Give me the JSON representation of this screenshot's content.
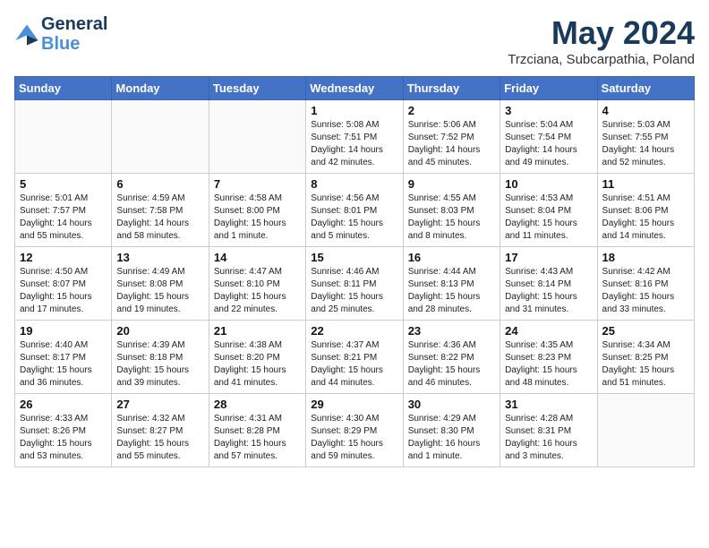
{
  "header": {
    "logo_line1": "General",
    "logo_line2": "Blue",
    "month_title": "May 2024",
    "location": "Trzciana, Subcarpathia, Poland"
  },
  "weekdays": [
    "Sunday",
    "Monday",
    "Tuesday",
    "Wednesday",
    "Thursday",
    "Friday",
    "Saturday"
  ],
  "weeks": [
    [
      {
        "day": "",
        "info": ""
      },
      {
        "day": "",
        "info": ""
      },
      {
        "day": "",
        "info": ""
      },
      {
        "day": "1",
        "info": "Sunrise: 5:08 AM\nSunset: 7:51 PM\nDaylight: 14 hours\nand 42 minutes."
      },
      {
        "day": "2",
        "info": "Sunrise: 5:06 AM\nSunset: 7:52 PM\nDaylight: 14 hours\nand 45 minutes."
      },
      {
        "day": "3",
        "info": "Sunrise: 5:04 AM\nSunset: 7:54 PM\nDaylight: 14 hours\nand 49 minutes."
      },
      {
        "day": "4",
        "info": "Sunrise: 5:03 AM\nSunset: 7:55 PM\nDaylight: 14 hours\nand 52 minutes."
      }
    ],
    [
      {
        "day": "5",
        "info": "Sunrise: 5:01 AM\nSunset: 7:57 PM\nDaylight: 14 hours\nand 55 minutes."
      },
      {
        "day": "6",
        "info": "Sunrise: 4:59 AM\nSunset: 7:58 PM\nDaylight: 14 hours\nand 58 minutes."
      },
      {
        "day": "7",
        "info": "Sunrise: 4:58 AM\nSunset: 8:00 PM\nDaylight: 15 hours\nand 1 minute."
      },
      {
        "day": "8",
        "info": "Sunrise: 4:56 AM\nSunset: 8:01 PM\nDaylight: 15 hours\nand 5 minutes."
      },
      {
        "day": "9",
        "info": "Sunrise: 4:55 AM\nSunset: 8:03 PM\nDaylight: 15 hours\nand 8 minutes."
      },
      {
        "day": "10",
        "info": "Sunrise: 4:53 AM\nSunset: 8:04 PM\nDaylight: 15 hours\nand 11 minutes."
      },
      {
        "day": "11",
        "info": "Sunrise: 4:51 AM\nSunset: 8:06 PM\nDaylight: 15 hours\nand 14 minutes."
      }
    ],
    [
      {
        "day": "12",
        "info": "Sunrise: 4:50 AM\nSunset: 8:07 PM\nDaylight: 15 hours\nand 17 minutes."
      },
      {
        "day": "13",
        "info": "Sunrise: 4:49 AM\nSunset: 8:08 PM\nDaylight: 15 hours\nand 19 minutes."
      },
      {
        "day": "14",
        "info": "Sunrise: 4:47 AM\nSunset: 8:10 PM\nDaylight: 15 hours\nand 22 minutes."
      },
      {
        "day": "15",
        "info": "Sunrise: 4:46 AM\nSunset: 8:11 PM\nDaylight: 15 hours\nand 25 minutes."
      },
      {
        "day": "16",
        "info": "Sunrise: 4:44 AM\nSunset: 8:13 PM\nDaylight: 15 hours\nand 28 minutes."
      },
      {
        "day": "17",
        "info": "Sunrise: 4:43 AM\nSunset: 8:14 PM\nDaylight: 15 hours\nand 31 minutes."
      },
      {
        "day": "18",
        "info": "Sunrise: 4:42 AM\nSunset: 8:16 PM\nDaylight: 15 hours\nand 33 minutes."
      }
    ],
    [
      {
        "day": "19",
        "info": "Sunrise: 4:40 AM\nSunset: 8:17 PM\nDaylight: 15 hours\nand 36 minutes."
      },
      {
        "day": "20",
        "info": "Sunrise: 4:39 AM\nSunset: 8:18 PM\nDaylight: 15 hours\nand 39 minutes."
      },
      {
        "day": "21",
        "info": "Sunrise: 4:38 AM\nSunset: 8:20 PM\nDaylight: 15 hours\nand 41 minutes."
      },
      {
        "day": "22",
        "info": "Sunrise: 4:37 AM\nSunset: 8:21 PM\nDaylight: 15 hours\nand 44 minutes."
      },
      {
        "day": "23",
        "info": "Sunrise: 4:36 AM\nSunset: 8:22 PM\nDaylight: 15 hours\nand 46 minutes."
      },
      {
        "day": "24",
        "info": "Sunrise: 4:35 AM\nSunset: 8:23 PM\nDaylight: 15 hours\nand 48 minutes."
      },
      {
        "day": "25",
        "info": "Sunrise: 4:34 AM\nSunset: 8:25 PM\nDaylight: 15 hours\nand 51 minutes."
      }
    ],
    [
      {
        "day": "26",
        "info": "Sunrise: 4:33 AM\nSunset: 8:26 PM\nDaylight: 15 hours\nand 53 minutes."
      },
      {
        "day": "27",
        "info": "Sunrise: 4:32 AM\nSunset: 8:27 PM\nDaylight: 15 hours\nand 55 minutes."
      },
      {
        "day": "28",
        "info": "Sunrise: 4:31 AM\nSunset: 8:28 PM\nDaylight: 15 hours\nand 57 minutes."
      },
      {
        "day": "29",
        "info": "Sunrise: 4:30 AM\nSunset: 8:29 PM\nDaylight: 15 hours\nand 59 minutes."
      },
      {
        "day": "30",
        "info": "Sunrise: 4:29 AM\nSunset: 8:30 PM\nDaylight: 16 hours\nand 1 minute."
      },
      {
        "day": "31",
        "info": "Sunrise: 4:28 AM\nSunset: 8:31 PM\nDaylight: 16 hours\nand 3 minutes."
      },
      {
        "day": "",
        "info": ""
      }
    ]
  ]
}
